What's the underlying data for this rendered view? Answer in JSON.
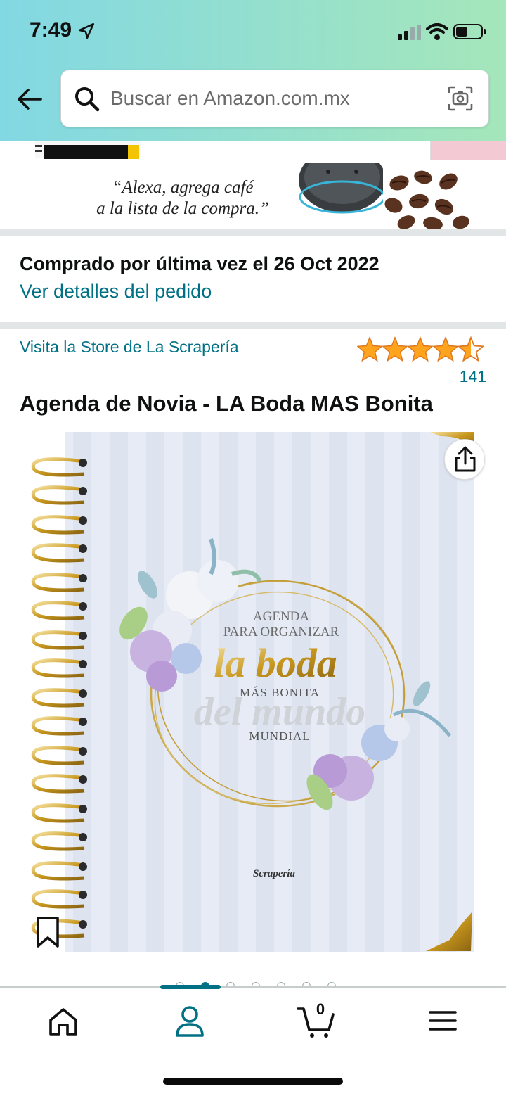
{
  "status_bar": {
    "time": "7:49"
  },
  "search": {
    "placeholder": "Buscar en Amazon.com.mx"
  },
  "ad": {
    "line1": "“Alexa, agrega café",
    "line2": "a la lista de la compra.”"
  },
  "purchase_history": {
    "title": "Comprado por última vez el 26 Oct 2022",
    "link": "Ver detalles del pedido"
  },
  "product": {
    "store_link": "Visita la Store de La Scrapería",
    "rating_stars": 4.5,
    "rating_count": "141",
    "title": "Agenda de Novia - LA Boda MAS Bonita",
    "image_text": {
      "agenda": "AGENDA",
      "para": "PARA ORGANIZAR",
      "la_boda": "la boda",
      "mas_bonita": "MÁS BONITA",
      "del_mundo": "del mundo",
      "mundial": "MUNDIAL",
      "brand": "Scrapería"
    }
  },
  "carousel": {
    "count": 7,
    "active": 1
  },
  "bottom_nav": {
    "cart_count": "0",
    "active": "account"
  },
  "colors": {
    "link": "#007185",
    "star": "#ffa41c",
    "header_start": "#82d8e3",
    "header_end": "#a5e6ba"
  }
}
